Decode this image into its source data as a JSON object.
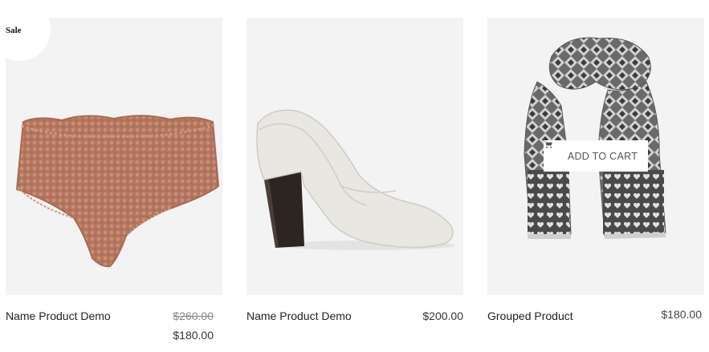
{
  "products": [
    {
      "name": "Name Product Demo",
      "badge": "Sale",
      "old_price": "$260.00",
      "price": "$180.00",
      "image_icon": "lace-briefs-image"
    },
    {
      "name": "Name Product Demo",
      "price": "$200.00",
      "image_icon": "white-heel-shoe-image"
    },
    {
      "name": "Grouped Product",
      "price": "$180.00",
      "image_icon": "patterned-scarf-image",
      "cart_button_label": "ADD TO CART"
    }
  ],
  "colors": {
    "thumb_background": "#f3f3f3",
    "lace": "#b5765f",
    "shoe_white": "#e9e7e2",
    "heel": "#2d2522",
    "scarf_dark": "#4a4a4a"
  }
}
